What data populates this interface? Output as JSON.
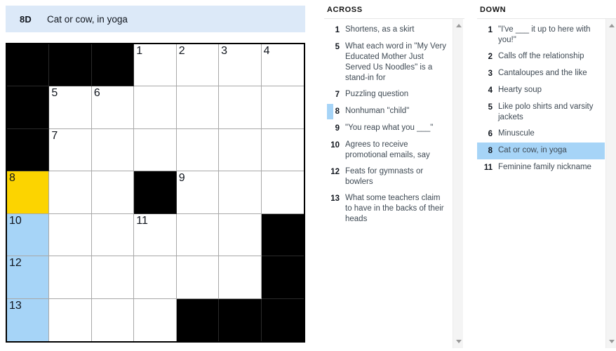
{
  "clue_bar": {
    "number": "8D",
    "text": "Cat or cow, in yoga"
  },
  "grid": {
    "rows": 7,
    "cols": 7,
    "colors": {
      "selected_cell": "#fcd400",
      "active_word": "#a6d4f7",
      "block": "#000000",
      "clue_bar_bg": "#dce9f8"
    },
    "cells": [
      [
        {
          "type": "block"
        },
        {
          "type": "block"
        },
        {
          "type": "block"
        },
        {
          "type": "open",
          "number": "1"
        },
        {
          "type": "open",
          "number": "2"
        },
        {
          "type": "open",
          "number": "3"
        },
        {
          "type": "open",
          "number": "4"
        }
      ],
      [
        {
          "type": "block"
        },
        {
          "type": "open",
          "number": "5"
        },
        {
          "type": "open",
          "number": "6"
        },
        {
          "type": "open"
        },
        {
          "type": "open"
        },
        {
          "type": "open"
        },
        {
          "type": "open"
        }
      ],
      [
        {
          "type": "block"
        },
        {
          "type": "open",
          "number": "7"
        },
        {
          "type": "open"
        },
        {
          "type": "open"
        },
        {
          "type": "open"
        },
        {
          "type": "open"
        },
        {
          "type": "open"
        }
      ],
      [
        {
          "type": "open",
          "number": "8",
          "state": "selected"
        },
        {
          "type": "open"
        },
        {
          "type": "open"
        },
        {
          "type": "block"
        },
        {
          "type": "open",
          "number": "9"
        },
        {
          "type": "open"
        },
        {
          "type": "open"
        }
      ],
      [
        {
          "type": "open",
          "number": "10",
          "state": "active"
        },
        {
          "type": "open"
        },
        {
          "type": "open"
        },
        {
          "type": "open",
          "number": "11"
        },
        {
          "type": "open"
        },
        {
          "type": "open"
        },
        {
          "type": "block"
        }
      ],
      [
        {
          "type": "open",
          "number": "12",
          "state": "active"
        },
        {
          "type": "open"
        },
        {
          "type": "open"
        },
        {
          "type": "open"
        },
        {
          "type": "open"
        },
        {
          "type": "open"
        },
        {
          "type": "block"
        }
      ],
      [
        {
          "type": "open",
          "number": "13",
          "state": "active"
        },
        {
          "type": "open"
        },
        {
          "type": "open"
        },
        {
          "type": "open"
        },
        {
          "type": "block"
        },
        {
          "type": "block"
        },
        {
          "type": "block"
        }
      ]
    ]
  },
  "across": {
    "heading": "ACROSS",
    "clues": [
      {
        "number": "1",
        "text": "Shortens, as a skirt",
        "state": "normal"
      },
      {
        "number": "5",
        "text": "What each word in \"My Very Educated Mother Just Served Us Noodles\" is a stand-in for",
        "state": "normal"
      },
      {
        "number": "7",
        "text": "Puzzling question",
        "state": "normal"
      },
      {
        "number": "8",
        "text": "Nonhuman \"child\"",
        "state": "marked"
      },
      {
        "number": "9",
        "text": "\"You reap what you ___\"",
        "state": "normal"
      },
      {
        "number": "10",
        "text": "Agrees to receive promotional emails, say",
        "state": "normal"
      },
      {
        "number": "12",
        "text": "Feats for gymnasts or bowlers",
        "state": "normal"
      },
      {
        "number": "13",
        "text": "What some teachers claim to have in the backs of their heads",
        "state": "normal"
      }
    ]
  },
  "down": {
    "heading": "DOWN",
    "clues": [
      {
        "number": "1",
        "text": "\"I've ___ it up to here with you!\"",
        "state": "normal"
      },
      {
        "number": "2",
        "text": "Calls off the relationship",
        "state": "normal"
      },
      {
        "number": "3",
        "text": "Cantaloupes and the like",
        "state": "normal"
      },
      {
        "number": "4",
        "text": "Hearty soup",
        "state": "normal"
      },
      {
        "number": "5",
        "text": "Like polo shirts and varsity jackets",
        "state": "normal"
      },
      {
        "number": "6",
        "text": "Minuscule",
        "state": "normal"
      },
      {
        "number": "8",
        "text": "Cat or cow, in yoga",
        "state": "selected"
      },
      {
        "number": "11",
        "text": "Feminine family nickname",
        "state": "normal"
      }
    ]
  },
  "scrollbars": {
    "up_arrow_icon": "chevron-up-icon",
    "down_arrow_icon": "chevron-down-icon"
  }
}
